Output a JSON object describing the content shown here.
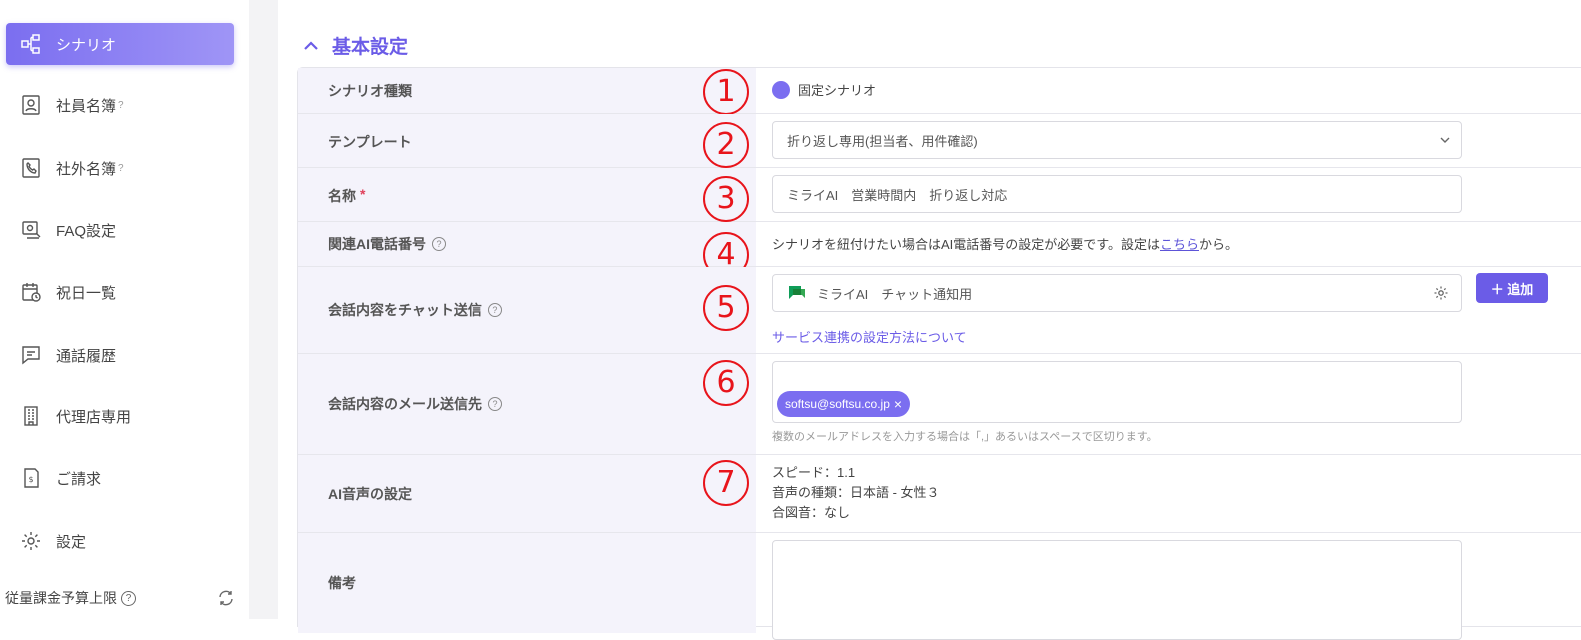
{
  "sidebar": {
    "items": [
      {
        "label": "シナリオ",
        "icon": "scenario-icon",
        "active": true
      },
      {
        "label": "社員名簿",
        "icon": "employee-directory-icon",
        "help": "?"
      },
      {
        "label": "社外名簿",
        "icon": "external-directory-icon",
        "help": "?"
      },
      {
        "label": "FAQ設定",
        "icon": "faq-icon"
      },
      {
        "label": "祝日一覧",
        "icon": "calendar-icon"
      },
      {
        "label": "通話履歴",
        "icon": "call-history-icon"
      },
      {
        "label": "代理店専用",
        "icon": "building-icon"
      },
      {
        "label": "ご請求",
        "icon": "invoice-icon"
      },
      {
        "label": "設定",
        "icon": "gear-icon"
      }
    ],
    "budget_label": "従量課金予算上限",
    "help": "?"
  },
  "section": {
    "title": "基本設定"
  },
  "form": {
    "scenario_type": {
      "label": "シナリオ種類",
      "value": "固定シナリオ",
      "num": "1"
    },
    "template": {
      "label": "テンプレート",
      "value": "折り返し専用(担当者、用件確認)",
      "num": "2"
    },
    "name": {
      "label": "名称",
      "required": "*",
      "value": "ミライAI　営業時間内　折り返し対応",
      "num": "3"
    },
    "ai_phone": {
      "label": "関連AI電話番号",
      "help": "?",
      "note_prefix": "シナリオを紐付けたい場合はAI電話番号の設定が必要です。設定は",
      "link": "こちら",
      "note_suffix": "から。",
      "num": "4"
    },
    "chat": {
      "label": "会話内容をチャット送信",
      "help": "?",
      "value": "ミライAI　チャット通知用",
      "add_button": "＋ 追加",
      "service_link": "サービス連携の設定方法について",
      "num": "5"
    },
    "mail": {
      "label": "会話内容のメール送信先",
      "help": "?",
      "tag": "softsu@softsu.co.jp",
      "tag_close": "×",
      "hint": "複数のメールアドレスを入力する場合は「,」あるいはスペースで区切ります。",
      "num": "6"
    },
    "voice": {
      "label": "AI音声の設定",
      "speed": "スピード：1.1",
      "type": "音声の種類：日本語 - 女性３",
      "chime": "合図音：なし",
      "num": "7"
    },
    "memo": {
      "label": "備考"
    }
  },
  "colors": {
    "accent": "#6b5ce7",
    "annotation": "#e8141b"
  }
}
